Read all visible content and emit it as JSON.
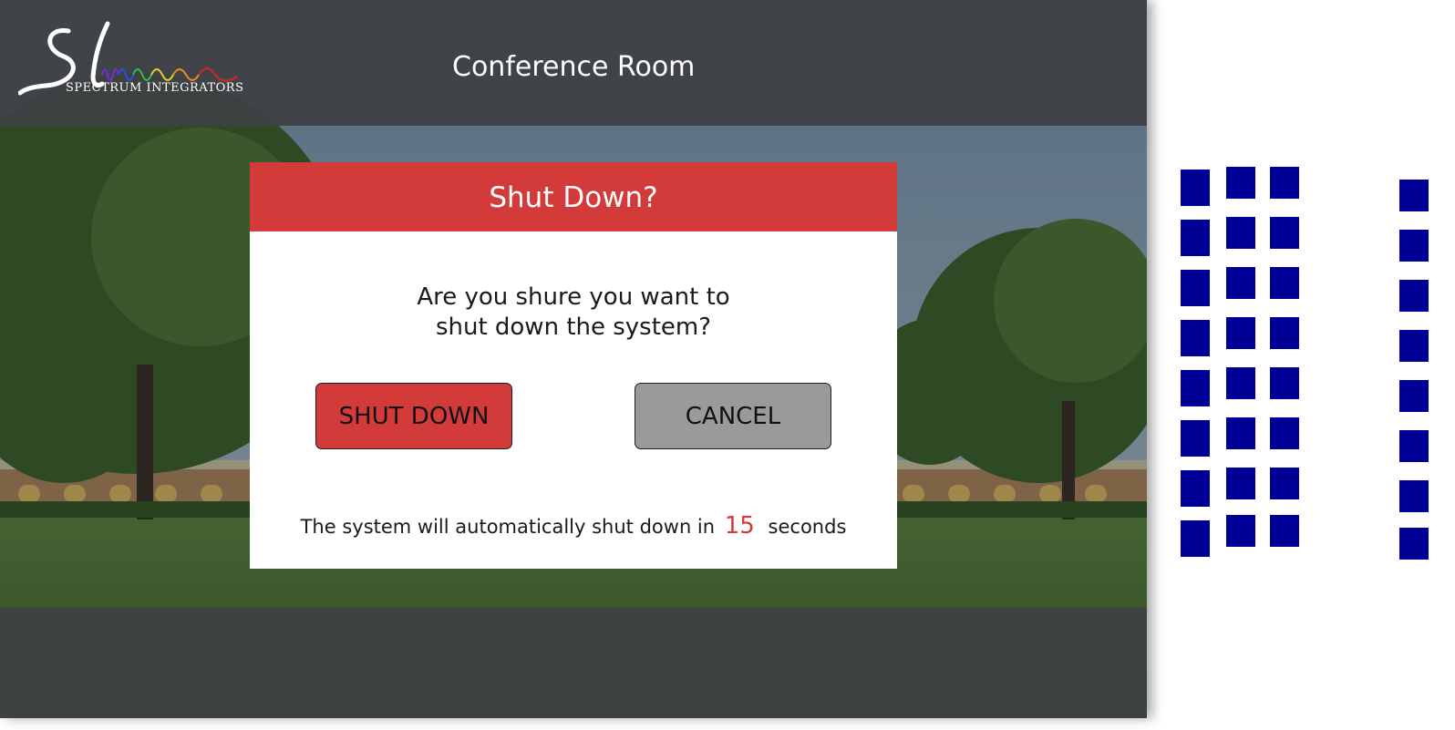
{
  "header": {
    "room_title": "Conference Room",
    "logo": {
      "mark": "SI",
      "text": "SPECTRUM INTEGRATORS"
    }
  },
  "dialog": {
    "title": "Shut Down?",
    "message_lines": [
      "Are you shure you want to",
      "shut down the system?"
    ],
    "confirm_label": "SHUT DOWN",
    "cancel_label": "CANCEL",
    "countdown_prefix": "The system will automatically shut down in",
    "countdown_value": "15",
    "countdown_suffix": "seconds"
  },
  "colors": {
    "accent_red": "#d33b3b",
    "cancel_gray": "#9a9a9a",
    "header_bar": "#3e4144",
    "button_grid_blue": "#000096"
  },
  "side_buttons": {
    "column_count": 4,
    "rows_per_column": 8
  }
}
